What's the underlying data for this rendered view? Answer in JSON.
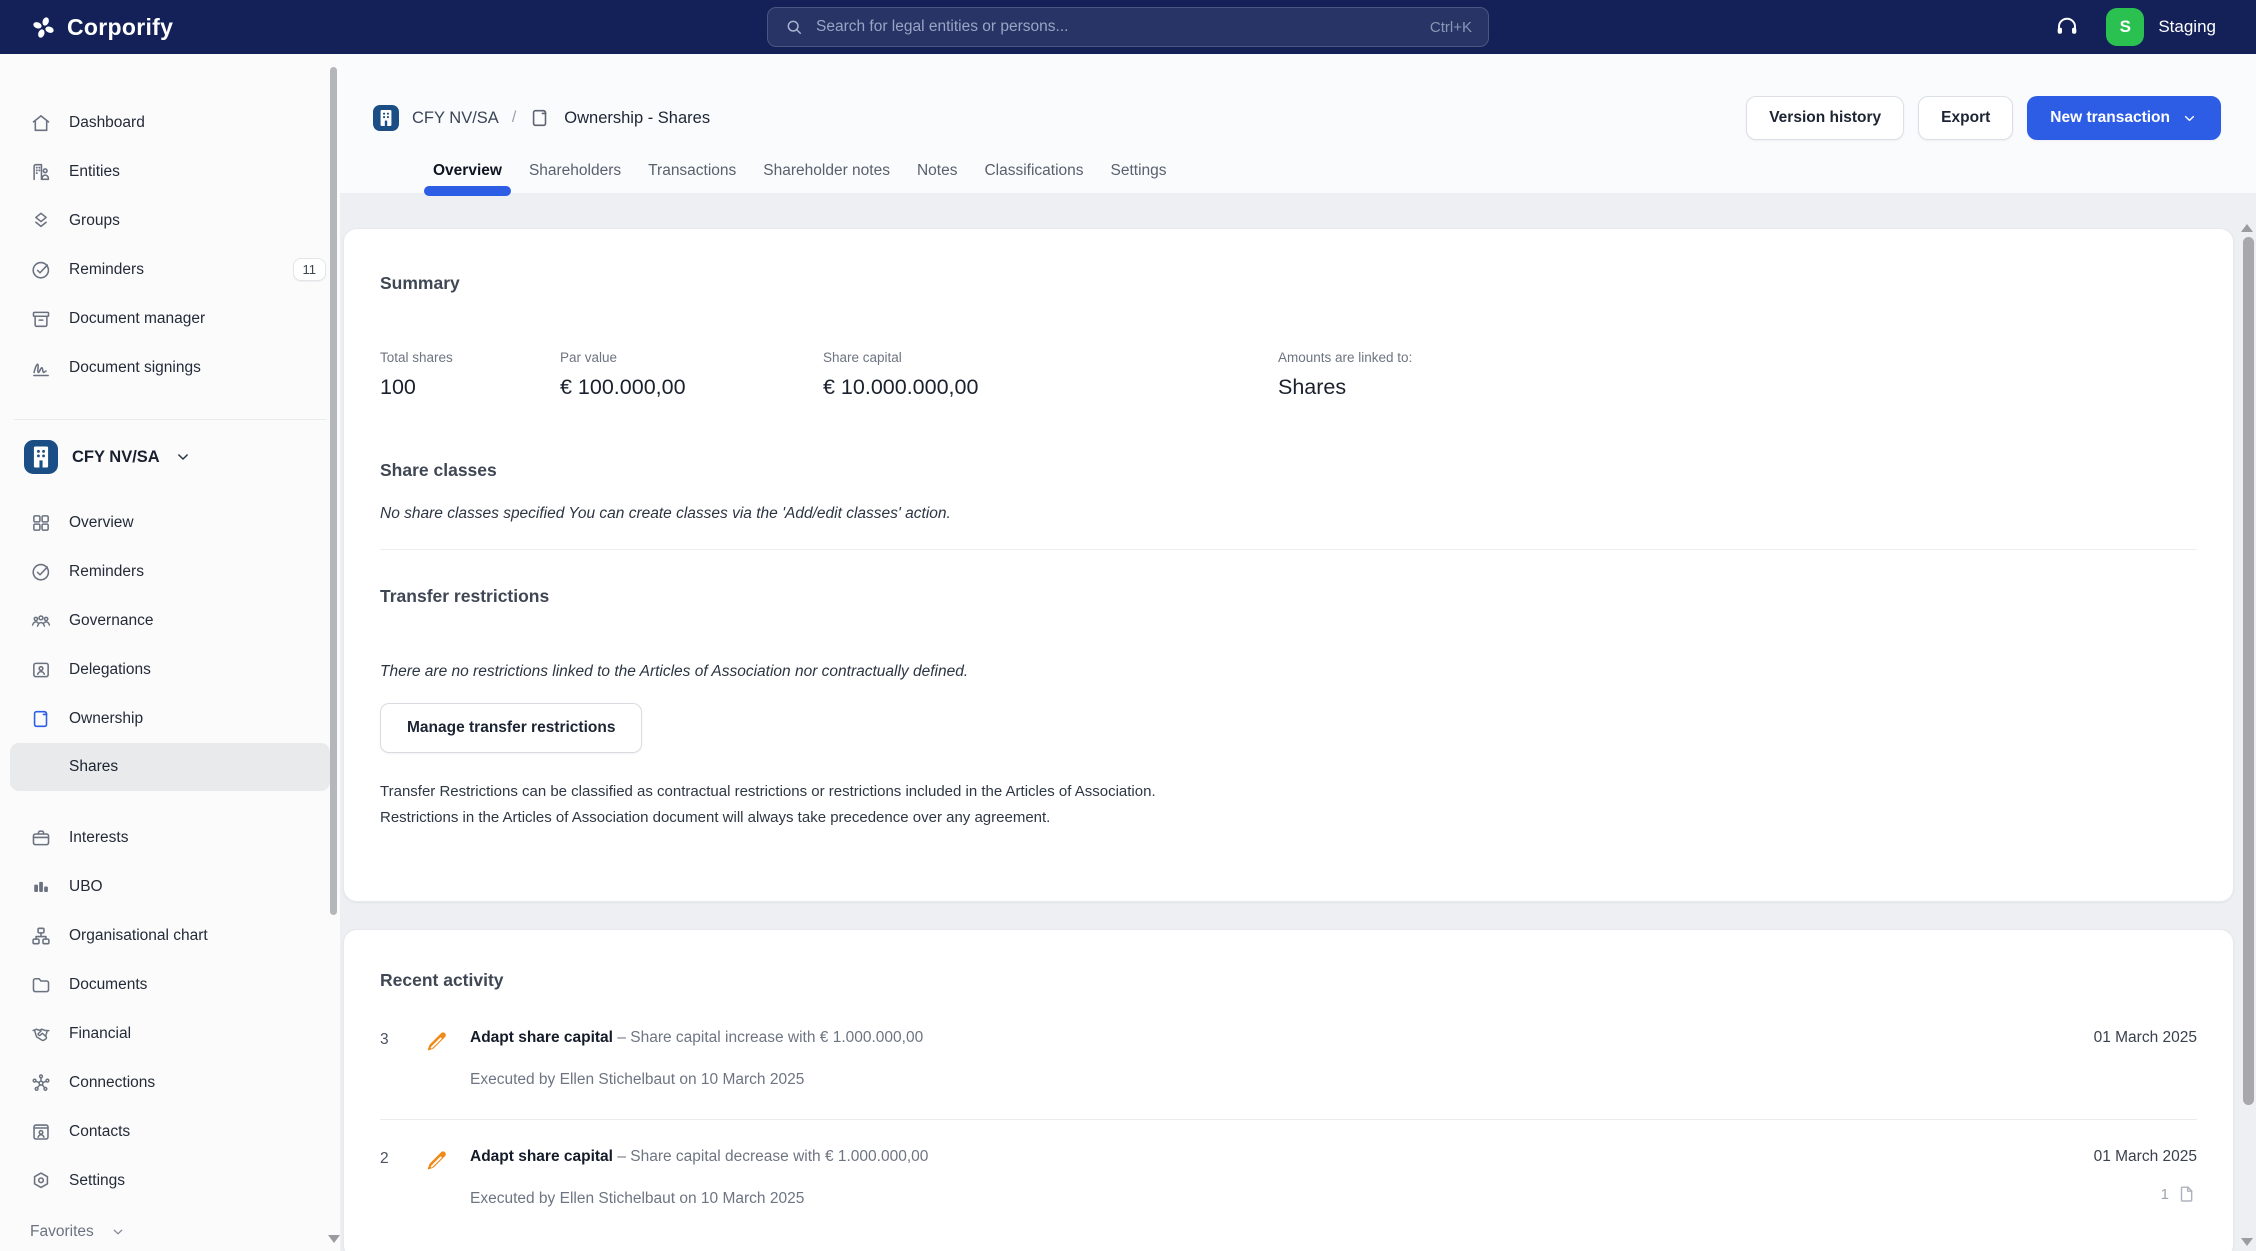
{
  "colors": {
    "topbar_navy": "#132158",
    "accent_blue": "#2d5de5",
    "entity_icon_blue": "#1b4e84",
    "staging_green": "#2bc150",
    "pencil_orange": "#f08a17"
  },
  "topbar": {
    "brand": "Corporify",
    "search_placeholder": "Search for legal entities or persons...",
    "search_shortcut": "Ctrl+K",
    "avatar_letter": "S",
    "environment_label": "Staging"
  },
  "sidebar": {
    "global_items": [
      {
        "label": "Dashboard"
      },
      {
        "label": "Entities"
      },
      {
        "label": "Groups"
      },
      {
        "label": "Reminders",
        "badge": "11"
      },
      {
        "label": "Document manager"
      },
      {
        "label": "Document signings"
      }
    ],
    "entity_name": "CFY NV/SA",
    "entity_items": [
      {
        "label": "Overview"
      },
      {
        "label": "Reminders"
      },
      {
        "label": "Governance"
      },
      {
        "label": "Delegations"
      },
      {
        "label": "Ownership"
      },
      {
        "label": "Shares"
      },
      {
        "label": "Interests"
      },
      {
        "label": "UBO"
      },
      {
        "label": "Organisational chart"
      },
      {
        "label": "Documents"
      },
      {
        "label": "Financial"
      },
      {
        "label": "Connections"
      },
      {
        "label": "Contacts"
      },
      {
        "label": "Settings"
      }
    ],
    "favorites_label": "Favorites"
  },
  "header": {
    "breadcrumb_entity": "CFY NV/SA",
    "breadcrumb_separator": "/",
    "breadcrumb_page": "Ownership - Shares",
    "actions": {
      "version_history": "Version history",
      "export": "Export",
      "new_transaction": "New transaction"
    },
    "tabs": [
      {
        "label": "Overview"
      },
      {
        "label": "Shareholders"
      },
      {
        "label": "Transactions"
      },
      {
        "label": "Shareholder notes"
      },
      {
        "label": "Notes"
      },
      {
        "label": "Classifications"
      },
      {
        "label": "Settings"
      }
    ]
  },
  "summary": {
    "title": "Summary",
    "stats": [
      {
        "label": "Total shares",
        "value": "100"
      },
      {
        "label": "Par value",
        "value": "€ 100.000,00"
      },
      {
        "label": "Share capital",
        "value": "€ 10.000.000,00"
      },
      {
        "label": "Amounts are linked to:",
        "value": "Shares"
      }
    ]
  },
  "share_classes": {
    "title": "Share classes",
    "empty_text": "No share classes specified You can create classes via the 'Add/edit classes' action."
  },
  "transfer_restrictions": {
    "title": "Transfer restrictions",
    "empty_text": "There are no restrictions linked to the Articles of Association nor contractually defined.",
    "button_label": "Manage transfer restrictions",
    "description_line1": "Transfer Restrictions can be classified as contractual restrictions or restrictions included in the Articles of Association.",
    "description_line2": "Restrictions in the Articles of Association document will always take precedence over any agreement."
  },
  "recent_activity": {
    "title": "Recent activity",
    "rows": [
      {
        "number": "3",
        "title": "Adapt share capital",
        "description": "– Share capital increase with € 1.000.000,00",
        "executed": "Executed by Ellen Stichelbaut on 10 March 2025",
        "date": "01 March 2025"
      },
      {
        "number": "2",
        "title": "Adapt share capital",
        "description": "– Share capital decrease with € 1.000.000,00",
        "executed": "Executed by Ellen Stichelbaut on 10 March 2025",
        "date": "01 March 2025",
        "doc_count": "1"
      }
    ]
  }
}
